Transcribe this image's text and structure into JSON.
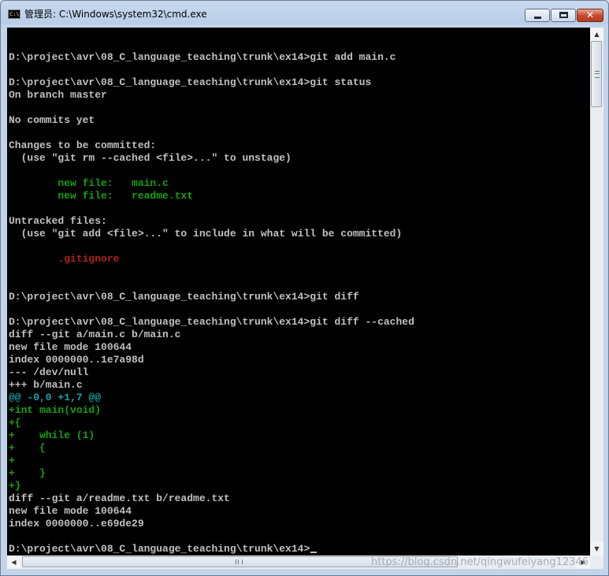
{
  "window": {
    "title": "管理员: C:\\Windows\\system32\\cmd.exe",
    "icon_text": "C:\\"
  },
  "controls": {
    "minimize_icon": "minimize-icon",
    "maximize_icon": "maximize-icon",
    "close_glyph": "✕"
  },
  "colors": {
    "console_bg": "#000000",
    "text": "#c0c0c0",
    "staged": "#13a10e",
    "untracked": "#b0201a",
    "diff_add": "#17a5a5"
  },
  "console": {
    "lines": [
      {
        "text": "",
        "color": "w"
      },
      {
        "text": "D:\\project\\avr\\08_C_language_teaching\\trunk\\ex14>git add main.c",
        "color": "w"
      },
      {
        "text": "",
        "color": "w"
      },
      {
        "text": "D:\\project\\avr\\08_C_language_teaching\\trunk\\ex14>git status",
        "color": "w"
      },
      {
        "text": "On branch master",
        "color": "w"
      },
      {
        "text": "",
        "color": "w"
      },
      {
        "text": "No commits yet",
        "color": "w"
      },
      {
        "text": "",
        "color": "w"
      },
      {
        "text": "Changes to be committed:",
        "color": "w"
      },
      {
        "text": "  (use \"git rm --cached <file>...\" to unstage)",
        "color": "w"
      },
      {
        "text": "",
        "color": "w"
      },
      {
        "text": "        new file:   main.c",
        "color": "g"
      },
      {
        "text": "        new file:   readme.txt",
        "color": "g"
      },
      {
        "text": "",
        "color": "w"
      },
      {
        "text": "Untracked files:",
        "color": "w"
      },
      {
        "text": "  (use \"git add <file>...\" to include in what will be committed)",
        "color": "w"
      },
      {
        "text": "",
        "color": "w"
      },
      {
        "text": "        .gitignore",
        "color": "r"
      },
      {
        "text": "",
        "color": "w"
      },
      {
        "text": "",
        "color": "w"
      },
      {
        "text": "D:\\project\\avr\\08_C_language_teaching\\trunk\\ex14>git diff",
        "color": "w"
      },
      {
        "text": "",
        "color": "w"
      },
      {
        "text": "D:\\project\\avr\\08_C_language_teaching\\trunk\\ex14>git diff --cached",
        "color": "w"
      },
      {
        "text": "diff --git a/main.c b/main.c",
        "color": "w"
      },
      {
        "text": "new file mode 100644",
        "color": "w"
      },
      {
        "text": "index 0000000..1e7a98d",
        "color": "w"
      },
      {
        "text": "--- /dev/null",
        "color": "w"
      },
      {
        "text": "+++ b/main.c",
        "color": "w"
      },
      {
        "text": "@@ -0,0 +1,7 @@",
        "color": "c"
      },
      {
        "text": "+int main(void)",
        "color": "g"
      },
      {
        "text": "+{",
        "color": "g"
      },
      {
        "text": "+    while (1)",
        "color": "g"
      },
      {
        "text": "+    {",
        "color": "g"
      },
      {
        "text": "+",
        "color": "g"
      },
      {
        "text": "+    }",
        "color": "g"
      },
      {
        "text": "+}",
        "color": "g"
      },
      {
        "text": "diff --git a/readme.txt b/readme.txt",
        "color": "w"
      },
      {
        "text": "new file mode 100644",
        "color": "w"
      },
      {
        "text": "index 0000000..e69de29",
        "color": "w"
      },
      {
        "text": "",
        "color": "w"
      },
      {
        "text": "D:\\project\\avr\\08_C_language_teaching\\trunk\\ex14>",
        "color": "w",
        "cursor": true
      }
    ]
  },
  "scrollbars": {
    "up_arrow": "▲",
    "down_arrow": "▼",
    "left_arrow": "◀",
    "right_arrow": "▶"
  },
  "watermark": "https://blog.csdn.net/qingwufeiyang12346"
}
